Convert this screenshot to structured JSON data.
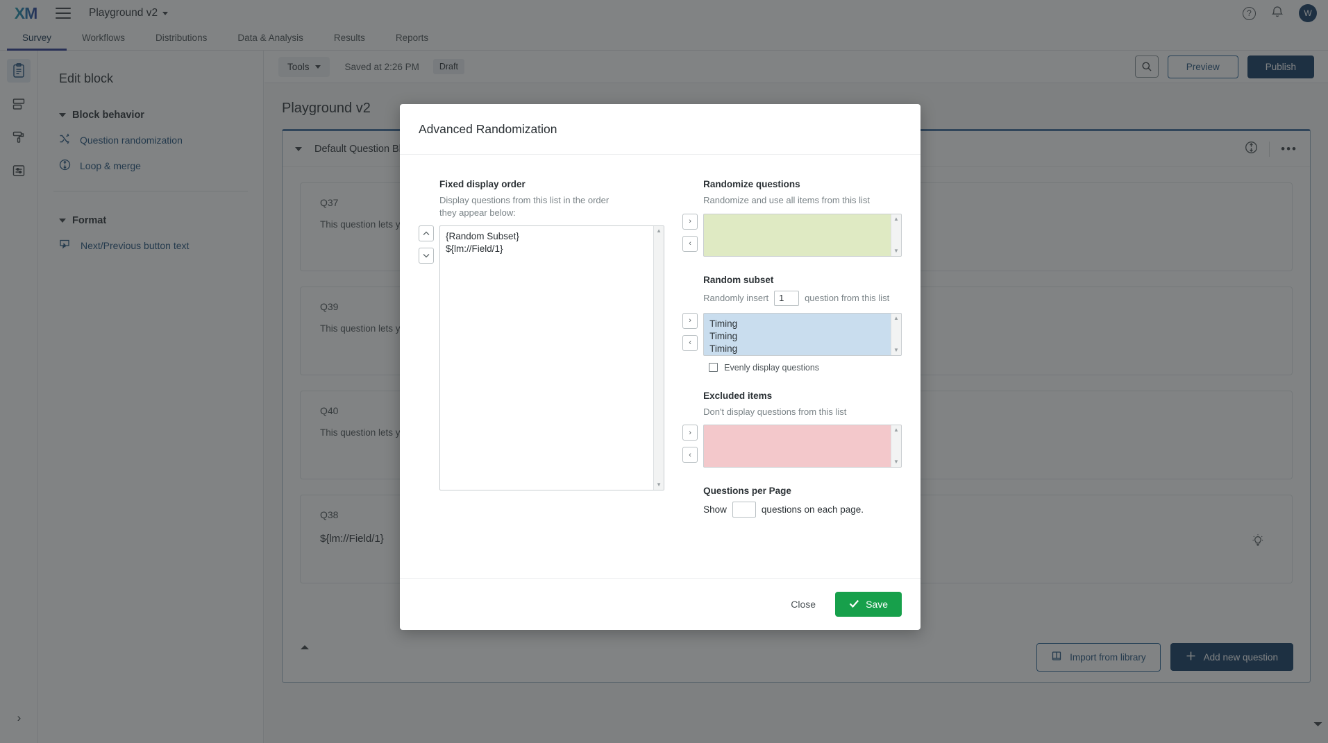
{
  "topbar": {
    "logo": "XM",
    "menu_icon": "hamburger-icon",
    "project_name": "Playground v2",
    "help_icon": "?",
    "notifications_icon": "bell-icon",
    "avatar_initial": "W"
  },
  "nav": {
    "tabs": [
      {
        "label": "Survey",
        "active": true
      },
      {
        "label": "Workflows",
        "active": false
      },
      {
        "label": "Distributions",
        "active": false
      },
      {
        "label": "Data & Analysis",
        "active": false
      },
      {
        "label": "Results",
        "active": false
      },
      {
        "label": "Reports",
        "active": false
      }
    ]
  },
  "rail": {
    "items": [
      "clipboard-icon",
      "blocks-icon",
      "paint-roller-icon",
      "sliders-icon"
    ],
    "expand_label": "›"
  },
  "leftpane": {
    "title": "Edit block",
    "sections": [
      {
        "title": "Block behavior",
        "items": [
          {
            "label": "Question randomization",
            "icon": "shuffle-icon"
          },
          {
            "label": "Loop & merge",
            "icon": "loop-merge-icon"
          }
        ]
      },
      {
        "title": "Format",
        "items": [
          {
            "label": "Next/Previous button text",
            "icon": "button-text-icon"
          }
        ]
      }
    ]
  },
  "toolbar": {
    "tools_label": "Tools",
    "saved_label": "Saved at 2:26 PM",
    "draft_label": "Draft",
    "search_icon": "search-icon",
    "preview_label": "Preview",
    "publish_label": "Publish"
  },
  "editor": {
    "survey_title": "Playground v2",
    "block_title": "Default Question Blo",
    "block_icons": [
      "loop-merge-icon",
      "more-options-icon"
    ],
    "questions": [
      {
        "id": "Q37",
        "text": "This question lets yo\nto the participant."
      },
      {
        "id": "Q39",
        "text": "This question lets yo\nto the participant."
      },
      {
        "id": "Q40",
        "text": "This question lets yo\nto the participant."
      },
      {
        "id": "Q38",
        "text": "${lm://Field/1}"
      }
    ],
    "import_label": "Import from library",
    "add_question_label": "Add new question"
  },
  "modal": {
    "title": "Advanced Randomization",
    "fixed_display": {
      "title": "Fixed display order",
      "subtitle": "Display questions from this list in the order they appear below:",
      "items": [
        "{Random Subset}",
        "${lm://Field/1}"
      ],
      "move_up_icon": "chevron-up-icon",
      "move_down_icon": "chevron-down-icon"
    },
    "randomize_questions": {
      "title": "Randomize questions",
      "subtitle": "Randomize and use all items from this list",
      "items": [],
      "color": "#dfeac3",
      "add_icon": "chevron-right-icon",
      "remove_icon": "chevron-left-icon"
    },
    "random_subset": {
      "title": "Random subset",
      "prefix": "Randomly insert",
      "count": "1",
      "suffix": "question from this list",
      "items": [
        "Timing",
        "Timing",
        "Timing"
      ],
      "color": "#c9ddee",
      "evenly_label": "Evenly display questions",
      "evenly_checked": false,
      "add_icon": "chevron-right-icon",
      "remove_icon": "chevron-left-icon"
    },
    "excluded_items": {
      "title": "Excluded items",
      "subtitle": "Don't display questions from this list",
      "items": [],
      "color": "#f3c8cb",
      "add_icon": "chevron-right-icon",
      "remove_icon": "chevron-left-icon"
    },
    "questions_per_page": {
      "title": "Questions per Page",
      "prefix": "Show",
      "value": "",
      "suffix": "questions on each page."
    },
    "close_label": "Close",
    "save_label": "Save",
    "save_icon": "check-icon"
  }
}
